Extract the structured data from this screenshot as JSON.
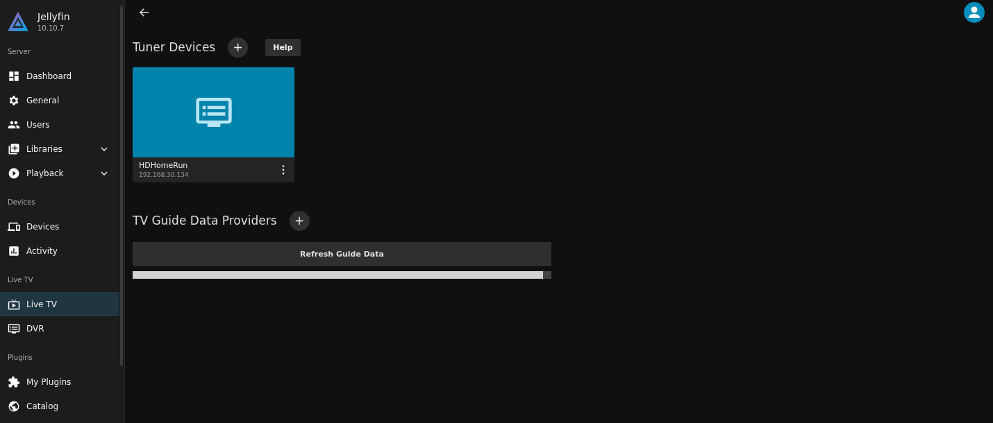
{
  "sidebar": {
    "app_name": "Jellyfin",
    "version": "10.10.7",
    "sections": [
      {
        "heading": "Server",
        "items": [
          {
            "label": "Dashboard",
            "selected": false
          },
          {
            "label": "General",
            "selected": false
          },
          {
            "label": "Users",
            "selected": false
          },
          {
            "label": "Libraries",
            "selected": false,
            "expanded": false
          },
          {
            "label": "Playback",
            "selected": false,
            "expanded": false
          }
        ]
      },
      {
        "heading": "Devices",
        "items": [
          {
            "label": "Devices",
            "selected": false
          },
          {
            "label": "Activity",
            "selected": false
          }
        ]
      },
      {
        "heading": "Live TV",
        "items": [
          {
            "label": "Live TV",
            "selected": true
          },
          {
            "label": "DVR",
            "selected": false
          }
        ]
      },
      {
        "heading": "Plugins",
        "items": [
          {
            "label": "My Plugins",
            "selected": false
          },
          {
            "label": "Catalog",
            "selected": false
          }
        ]
      }
    ]
  },
  "tuner_devices": {
    "title": "Tuner Devices",
    "add_button": "+",
    "help_button": "Help",
    "devices": [
      {
        "name": "HDHomeRun",
        "address": "192.168.30.134"
      }
    ]
  },
  "guide_providers": {
    "title": "TV Guide Data Providers",
    "add_button": "+",
    "refresh_button": "Refresh Guide Data",
    "progress": {
      "level": 0.98
    }
  }
}
